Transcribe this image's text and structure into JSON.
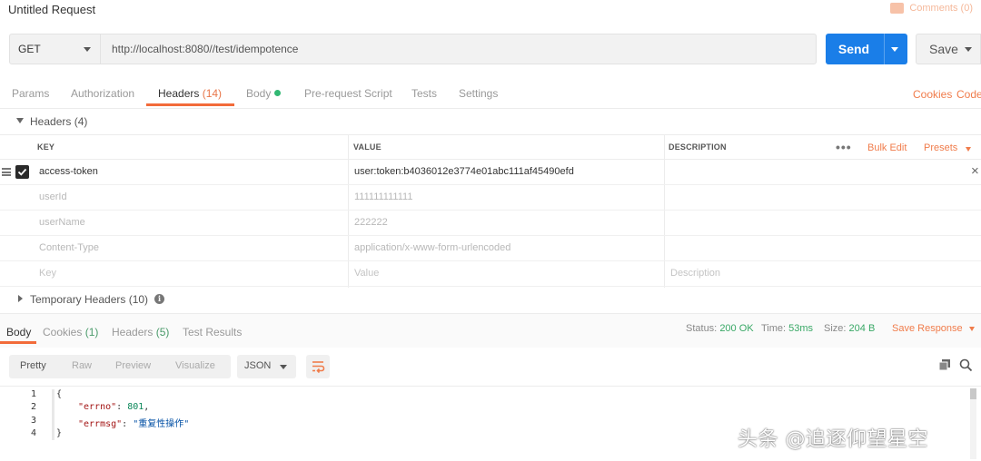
{
  "title": "Untitled Request",
  "comments_label": "Comments (0)",
  "request": {
    "method": "GET",
    "url": "http://localhost:8080//test/idempotence",
    "send_label": "Send",
    "save_label": "Save"
  },
  "tabs": {
    "params": "Params",
    "authorization": "Authorization",
    "headers": "Headers",
    "headers_count": "(14)",
    "body": "Body",
    "prerequest": "Pre-request Script",
    "tests": "Tests",
    "settings": "Settings",
    "cookies": "Cookies",
    "code": "Code"
  },
  "headers_section": {
    "title": "Headers (4)",
    "columns": {
      "key": "KEY",
      "value": "VALUE",
      "description": "DESCRIPTION"
    },
    "more": "•••",
    "bulk_edit": "Bulk Edit",
    "presets": "Presets",
    "rows": [
      {
        "key": "access-token",
        "value": "user:token:b4036012e3774e01abc111af45490efd",
        "description": "",
        "enabled": true
      },
      {
        "key": "userId",
        "value": "111111111111",
        "description": "",
        "enabled": false
      },
      {
        "key": "userName",
        "value": "222222",
        "description": "",
        "enabled": false
      },
      {
        "key": "Content-Type",
        "value": "application/x-www-form-urlencoded",
        "description": "",
        "enabled": false
      }
    ],
    "placeholder": {
      "key": "Key",
      "value": "Value",
      "description": "Description"
    }
  },
  "temporary_headers": {
    "title": "Temporary Headers (10)"
  },
  "response": {
    "tabs": {
      "body": "Body",
      "cookies": "Cookies",
      "cookies_count": "(1)",
      "headers": "Headers",
      "headers_count": "(5)",
      "test_results": "Test Results"
    },
    "status_label": "Status:",
    "status_value": "200 OK",
    "time_label": "Time:",
    "time_value": "53ms",
    "size_label": "Size:",
    "size_value": "204 B",
    "save_response": "Save Response",
    "views": {
      "pretty": "Pretty",
      "raw": "Raw",
      "preview": "Preview",
      "visualize": "Visualize"
    },
    "format": "JSON",
    "line_numbers": [
      "1",
      "2",
      "3",
      "4"
    ],
    "code": {
      "open": "{",
      "key1": "\"errno\"",
      "val1": "801",
      "key2": "\"errmsg\"",
      "val2": "\"重复性操作\"",
      "close": "}"
    }
  },
  "watermark": "头条 @追逐仰望星空"
}
